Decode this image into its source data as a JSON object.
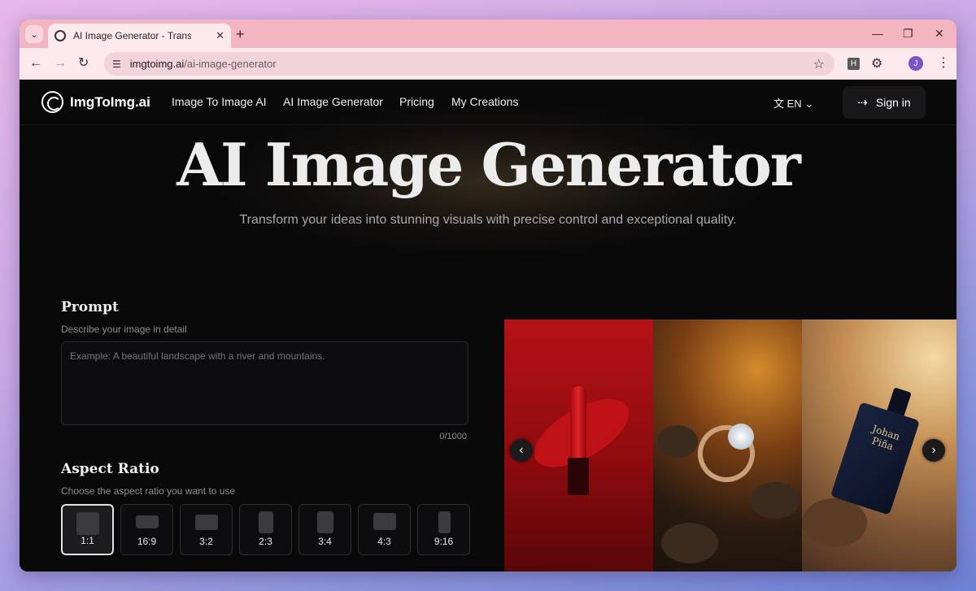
{
  "browser": {
    "tab_title": "AI Image Generator - Transform",
    "url_host": "imgtoimg.ai",
    "url_path": "/ai-image-generator",
    "profile_initial": "J",
    "extension_label": "H"
  },
  "site": {
    "logo_text": "ImgToImg.ai",
    "nav": [
      "Image To Image AI",
      "AI Image Generator",
      "Pricing",
      "My Creations"
    ],
    "language": "EN",
    "signin_label": "Sign in",
    "hero_title": "AI Image Generator",
    "hero_subtitle": "Transform your ideas into stunning visuals with precise control and exceptional quality.",
    "prompt": {
      "title": "Prompt",
      "description": "Describe your image in detail",
      "placeholder": "Example: A beautiful landscape with a river and mountains.",
      "counter": "0/1000"
    },
    "aspect_ratio": {
      "title": "Aspect Ratio",
      "description": "Choose the aspect ratio you want to use",
      "options": [
        "1:1",
        "16:9",
        "3:2",
        "2:3",
        "3:4",
        "4:3",
        "9:16"
      ],
      "selected": "1:1"
    },
    "gallery": {
      "perfume_label_line1": "Johan",
      "perfume_label_line2": "Piña"
    }
  }
}
